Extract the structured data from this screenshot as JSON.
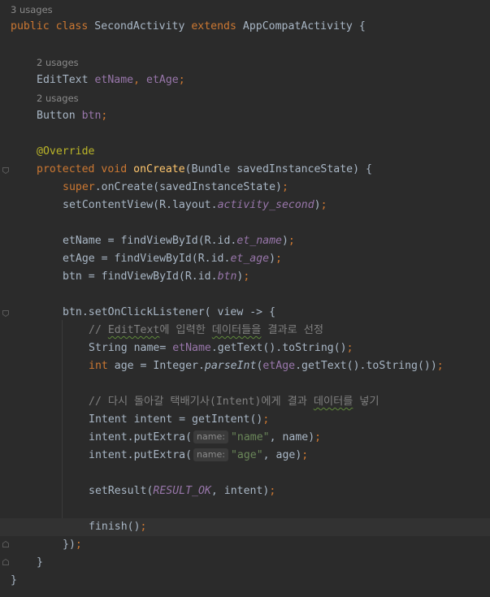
{
  "usages": {
    "class": "3 usages",
    "fields1": "2 usages",
    "fields2": "2 usages"
  },
  "code": {
    "l1": {
      "k1": "public",
      "k2": "class",
      "name": "SecondActivity",
      "k3": "extends",
      "parent": "AppCompatActivity",
      "brace": " {"
    },
    "l3": {
      "type": "EditText",
      "f1": "etName",
      "sep": ", ",
      "f2": "etAge",
      "semi": ";"
    },
    "l5": {
      "type": "Button",
      "f1": "btn",
      "semi": ";"
    },
    "l7": {
      "ann": "@Override"
    },
    "l8": {
      "k1": "protected",
      "k2": "void",
      "fn": "onCreate",
      "args": "(Bundle savedInstanceState) {"
    },
    "l9": {
      "k": "super",
      "rest": ".onCreate(savedInstanceState)",
      "semi": ";"
    },
    "l10": {
      "a": "setContentView(R.layout.",
      "f": "activity_second",
      "b": ")",
      "semi": ";"
    },
    "l12": {
      "a": "etName = findViewById(R.id.",
      "f": "et_name",
      "b": ")",
      "semi": ";"
    },
    "l13": {
      "a": "etAge = findViewById(R.id.",
      "f": "et_age",
      "b": ")",
      "semi": ";"
    },
    "l14": {
      "a": "btn = findViewById(R.id.",
      "f": "btn",
      "b": ")",
      "semi": ";"
    },
    "l16": {
      "a": "btn.setOnClickListener( view -> {"
    },
    "l17": {
      "c1": "// ",
      "c2": "EditText",
      "c3": "에 입력한 ",
      "c4": "데이터들을",
      "c5": " 결과로 선정"
    },
    "l18": {
      "a": "String name= ",
      "f": "etName",
      "b": ".getText().toString()",
      "semi": ";"
    },
    "l19": {
      "k": "int",
      "a": " age = Integer.",
      "s": "parseInt",
      "b": "(",
      "f": "etAge",
      "c": ".getText().toString())",
      "semi": ";"
    },
    "l21": {
      "c1": "// 다시 돌아갈 택배기사(Intent)에게 결과 ",
      "c2": "데이터를",
      "c3": " 넣기"
    },
    "l22": {
      "a": "Intent intent = getIntent()",
      "semi": ";"
    },
    "l23": {
      "a": "intent.putExtra(",
      "hint": "name:",
      "s": "\"name\"",
      "b": ", name)",
      "semi": ";"
    },
    "l24": {
      "a": "intent.putExtra(",
      "hint": "name:",
      "s": "\"age\"",
      "b": ", age)",
      "semi": ";"
    },
    "l26": {
      "a": "setResult(",
      "st": "RESULT_OK",
      "b": ", intent)",
      "semi": ";"
    },
    "l28": {
      "a": "finish()",
      "semi": ";"
    },
    "l29": {
      "a": "})",
      "semi": ";"
    },
    "l30": {
      "a": "}"
    },
    "l31": {
      "a": "}"
    }
  }
}
